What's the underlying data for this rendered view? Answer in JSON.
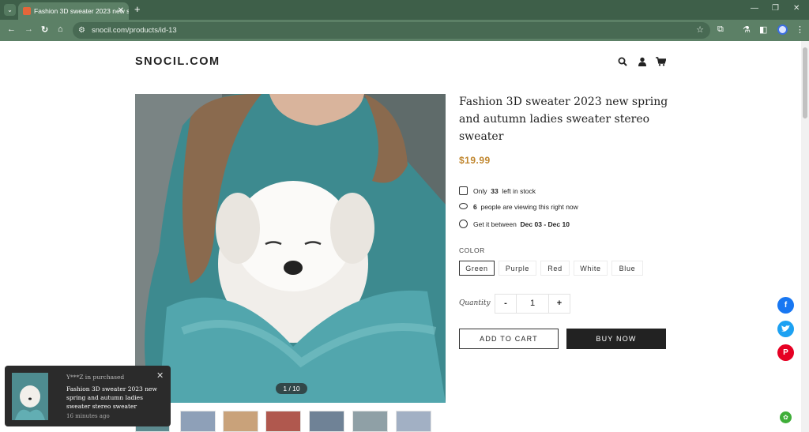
{
  "browser": {
    "tab_title": "Fashion 3D sweater 2023 new s",
    "tab_close": "✕",
    "new_tab": "+",
    "url": "snocil.com/products/id-13",
    "window_controls": [
      "—",
      "❐",
      "✕"
    ]
  },
  "header": {
    "logo": "SNOCIL.COM",
    "icons": [
      "search-icon",
      "account-icon",
      "cart-icon"
    ]
  },
  "gallery": {
    "counter": "1 / 10",
    "thumbnail_colors": [
      "#5c8a8f",
      "#8ea0b8",
      "#c9a27a",
      "#b0584e",
      "#6f8296",
      "#8fa0a6",
      "#a2b0c4"
    ]
  },
  "product": {
    "title": "Fashion 3D sweater 2023 new spring and autumn ladies sweater stereo sweater",
    "price": "$19.99",
    "stock_prefix": "Only",
    "stock_count": "33",
    "stock_suffix": "left in stock",
    "viewers_count": "6",
    "viewers_suffix": "people are viewing this right now",
    "delivery_prefix": "Get it between",
    "delivery_range": "Dec 03 - Dec 10",
    "color_label": "COLOR",
    "colors": [
      "Green",
      "Purple",
      "Red",
      "White",
      "Blue"
    ],
    "selected_color": "Green",
    "quantity_label": "Quantity",
    "quantity_minus": "-",
    "quantity_value": "1",
    "quantity_plus": "+",
    "add_to_cart": "ADD TO CART",
    "buy_now": "BUY NOW"
  },
  "share": {
    "icons": [
      "facebook-icon",
      "twitter-icon",
      "pinterest-icon"
    ],
    "colors": {
      "facebook": "#1877f2",
      "twitter": "#1da1f2",
      "pinterest": "#e60023"
    }
  },
  "popup": {
    "who": "Y***Z in purchased",
    "close": "✕",
    "product_name": "Fashion 3D sweater 2023 new spring and autumn ladies sweater stereo sweater",
    "when": "16 minutes ago"
  },
  "colors": {
    "browser_frame": "#3e5f49",
    "toolbar": "#5c8066",
    "price": "#c0862e",
    "buy_now_bg": "#222222"
  }
}
